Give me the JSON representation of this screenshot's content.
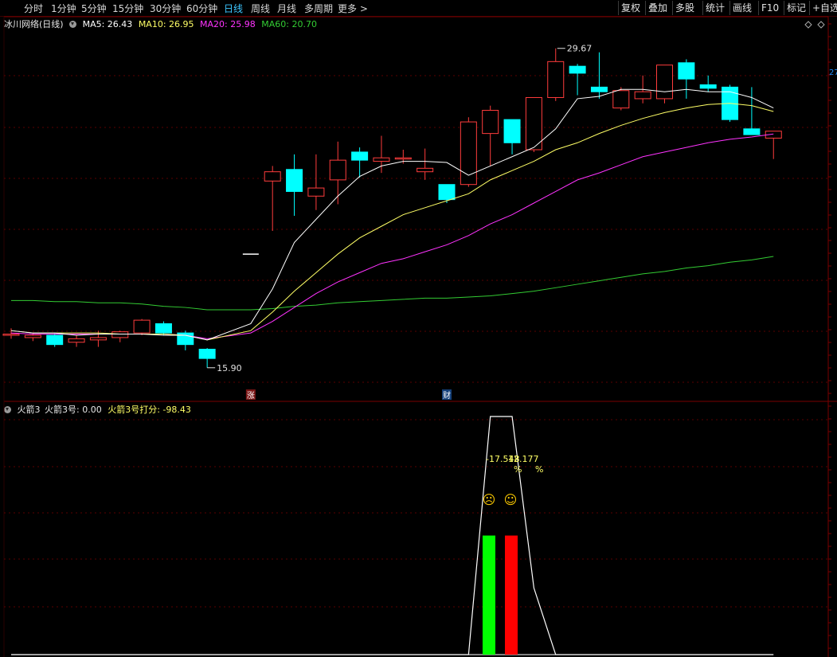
{
  "toolbar": {
    "periods": [
      "分时",
      "1分钟",
      "5分钟",
      "15分钟",
      "30分钟",
      "60分钟",
      "日线",
      "周线",
      "月线",
      "多周期",
      "更多 >"
    ],
    "active_index": 6,
    "right_buttons": [
      "复权",
      "叠加",
      "多股",
      "统计",
      "画线",
      "F10",
      "标记",
      "+自选"
    ]
  },
  "main_header": {
    "stock": "冰川网络(日线)",
    "ma5": "MA5: 26.43",
    "ma10": "MA10: 26.95",
    "ma20": "MA20: 25.98",
    "ma60": "MA60: 20.70"
  },
  "indicator_header": {
    "name": "火箭3",
    "value": "火箭3号: 0.00",
    "score": "火箭3号打分: -98.43"
  },
  "annotations": {
    "high_label": "29.67",
    "low_label": "15.90",
    "marker_zhang": "涨",
    "marker_cai": "财",
    "pct_left": "-17.548",
    "pct_right": "12.177",
    "pct_sign": "%",
    "sad_face": "☹",
    "happy_face": "☺",
    "right_axis_label": "27"
  },
  "colors": {
    "up": "#ff3c3c",
    "down": "#00ffff",
    "ma5": "#ffffff",
    "ma10": "#ffff66",
    "ma20": "#ff33ff",
    "ma60": "#33cc33",
    "grid": "#5a0000",
    "frame": "#7a0000"
  },
  "chart_data": [
    {
      "type": "candlestick",
      "title": "冰川网络(日线)",
      "ylim": [
        15.0,
        31.0
      ],
      "candles": [
        {
          "o": 17.35,
          "h": 17.6,
          "l": 17.15,
          "c": 17.35
        },
        {
          "o": 17.2,
          "h": 17.4,
          "l": 17.05,
          "c": 17.3
        },
        {
          "o": 17.3,
          "h": 17.4,
          "l": 16.8,
          "c": 16.9
        },
        {
          "o": 17.0,
          "h": 17.3,
          "l": 16.8,
          "c": 17.15
        },
        {
          "o": 17.1,
          "h": 17.5,
          "l": 16.8,
          "c": 17.2
        },
        {
          "o": 17.2,
          "h": 17.5,
          "l": 17.0,
          "c": 17.45
        },
        {
          "o": 17.4,
          "h": 18.0,
          "l": 17.3,
          "c": 17.95
        },
        {
          "o": 17.8,
          "h": 17.9,
          "l": 17.3,
          "c": 17.4
        },
        {
          "o": 17.4,
          "h": 17.5,
          "l": 16.65,
          "c": 16.9
        },
        {
          "o": 16.7,
          "h": 16.75,
          "l": 15.9,
          "c": 16.3
        },
        {
          "o": null,
          "h": null,
          "l": null,
          "c": null
        },
        {
          "o": 20.8,
          "h": 20.8,
          "l": 20.8,
          "c": 20.8
        },
        {
          "o": 23.95,
          "h": 24.6,
          "l": 21.8,
          "c": 24.35
        },
        {
          "o": 24.45,
          "h": 25.1,
          "l": 22.45,
          "c": 23.5
        },
        {
          "o": 23.3,
          "h": 25.1,
          "l": 22.7,
          "c": 23.65
        },
        {
          "o": 24.0,
          "h": 25.65,
          "l": 22.95,
          "c": 24.85
        },
        {
          "o": 25.2,
          "h": 25.4,
          "l": 24.1,
          "c": 24.85
        },
        {
          "o": 24.8,
          "h": 25.9,
          "l": 24.3,
          "c": 24.95
        },
        {
          "o": 24.95,
          "h": 25.3,
          "l": 24.7,
          "c": 24.95
        },
        {
          "o": 24.35,
          "h": 25.35,
          "l": 24.0,
          "c": 24.5
        },
        {
          "o": 23.8,
          "h": 23.8,
          "l": 23.0,
          "c": 23.15
        },
        {
          "o": 23.8,
          "h": 26.7,
          "l": 23.7,
          "c": 26.5
        },
        {
          "o": 26.0,
          "h": 27.2,
          "l": 24.6,
          "c": 27.0
        },
        {
          "o": 26.6,
          "h": 26.6,
          "l": 25.1,
          "c": 25.6
        },
        {
          "o": 25.3,
          "h": 27.5,
          "l": 25.2,
          "c": 27.55
        },
        {
          "o": 27.55,
          "h": 29.67,
          "l": 27.4,
          "c": 29.1
        },
        {
          "o": 28.9,
          "h": 29.0,
          "l": 27.65,
          "c": 28.6
        },
        {
          "o": 28.0,
          "h": 29.5,
          "l": 27.5,
          "c": 27.8
        },
        {
          "o": 27.1,
          "h": 28.0,
          "l": 27.0,
          "c": 27.85
        },
        {
          "o": 27.5,
          "h": 28.5,
          "l": 27.3,
          "c": 27.8
        },
        {
          "o": 27.5,
          "h": 28.9,
          "l": 27.3,
          "c": 28.95
        },
        {
          "o": 29.05,
          "h": 29.2,
          "l": 27.5,
          "c": 28.35
        },
        {
          "o": 28.1,
          "h": 28.5,
          "l": 27.8,
          "c": 27.95
        },
        {
          "o": 28.0,
          "h": 28.1,
          "l": 26.5,
          "c": 26.6
        },
        {
          "o": 26.2,
          "h": 28.0,
          "l": 26.05,
          "c": 25.95
        },
        {
          "o": 25.8,
          "h": 26.0,
          "l": 24.9,
          "c": 26.1
        }
      ],
      "ma5": [
        17.5,
        17.4,
        17.4,
        17.3,
        17.35,
        17.35,
        17.35,
        17.3,
        17.3,
        17.1,
        17.8,
        19.3,
        21.3,
        22.3,
        23.3,
        24.15,
        24.6,
        24.8,
        24.8,
        24.75,
        24.2,
        24.6,
        25.0,
        25.4,
        26.2,
        27.5,
        27.6,
        27.9,
        27.9,
        27.8,
        27.9,
        27.8,
        27.8,
        27.55,
        27.1
      ],
      "ma10": [
        17.5,
        17.4,
        17.4,
        17.4,
        17.4,
        17.35,
        17.35,
        17.35,
        17.3,
        17.1,
        17.5,
        18.3,
        19.2,
        20.0,
        20.8,
        21.5,
        22.0,
        22.5,
        22.8,
        23.1,
        23.4,
        24.0,
        24.4,
        24.8,
        25.3,
        25.6,
        26.0,
        26.35,
        26.65,
        26.9,
        27.1,
        27.25,
        27.3,
        27.2,
        26.95
      ],
      "ma20": [
        17.4,
        17.35,
        17.35,
        17.35,
        17.35,
        17.35,
        17.35,
        17.35,
        17.3,
        17.15,
        17.4,
        17.9,
        18.5,
        19.1,
        19.6,
        20.0,
        20.4,
        20.6,
        20.9,
        21.2,
        21.6,
        22.1,
        22.5,
        23.0,
        23.5,
        24.0,
        24.3,
        24.65,
        25.0,
        25.2,
        25.4,
        25.6,
        25.75,
        25.85,
        25.98
      ],
      "ma60": [
        18.8,
        18.8,
        18.75,
        18.75,
        18.7,
        18.7,
        18.65,
        18.55,
        18.5,
        18.4,
        18.4,
        18.45,
        18.55,
        18.6,
        18.7,
        18.75,
        18.8,
        18.85,
        18.9,
        18.9,
        18.95,
        19.0,
        19.1,
        19.2,
        19.35,
        19.5,
        19.65,
        19.8,
        19.95,
        20.05,
        20.2,
        20.3,
        20.45,
        20.55,
        20.7
      ],
      "high": 29.67,
      "low": 15.9
    },
    {
      "type": "bar",
      "title": "火箭3",
      "ylim": [
        0,
        100
      ],
      "bars": [
        {
          "name": "-17.548",
          "value": 50,
          "color": "#00ff00"
        },
        {
          "name": "12.177",
          "value": 50,
          "color": "#ff0000"
        }
      ],
      "line": [
        0,
        0,
        0,
        0,
        0,
        0,
        0,
        0,
        0,
        0,
        0,
        0,
        0,
        0,
        0,
        0,
        0,
        0,
        0,
        0,
        0,
        100,
        100,
        28,
        0,
        0,
        0,
        0,
        0,
        0,
        0,
        0,
        0,
        0,
        0
      ]
    }
  ]
}
